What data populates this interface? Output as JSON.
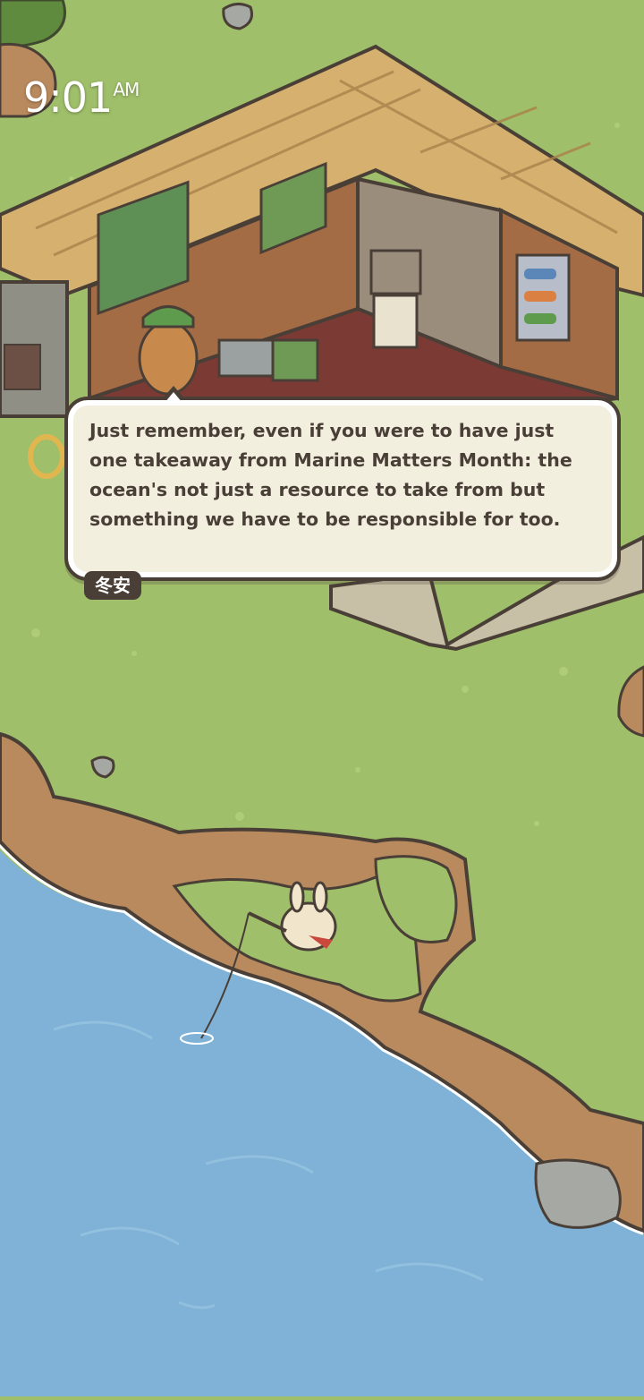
{
  "status_bar": {
    "time": "9:01",
    "ampm": "AM"
  },
  "dialog": {
    "text": "Just remember, even if you were to have just one takeaway from Marine Matters Month: the ocean's not just a resource to take from but something we have to be responsible for too.",
    "speaker": "冬安"
  },
  "colors": {
    "grass": "#9fbf6a",
    "water": "#7fb2d6",
    "cliff": "#b98a5e",
    "dialog_bg": "#f3efdf",
    "dialog_border": "#4a3f37"
  }
}
